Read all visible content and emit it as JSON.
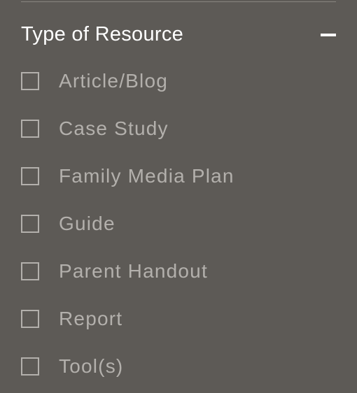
{
  "filter": {
    "title": "Type of Resource",
    "options": [
      {
        "label": "Article/Blog"
      },
      {
        "label": "Case Study"
      },
      {
        "label": "Family Media Plan"
      },
      {
        "label": "Guide"
      },
      {
        "label": "Parent Handout"
      },
      {
        "label": "Report"
      },
      {
        "label": "Tool(s)"
      }
    ]
  }
}
